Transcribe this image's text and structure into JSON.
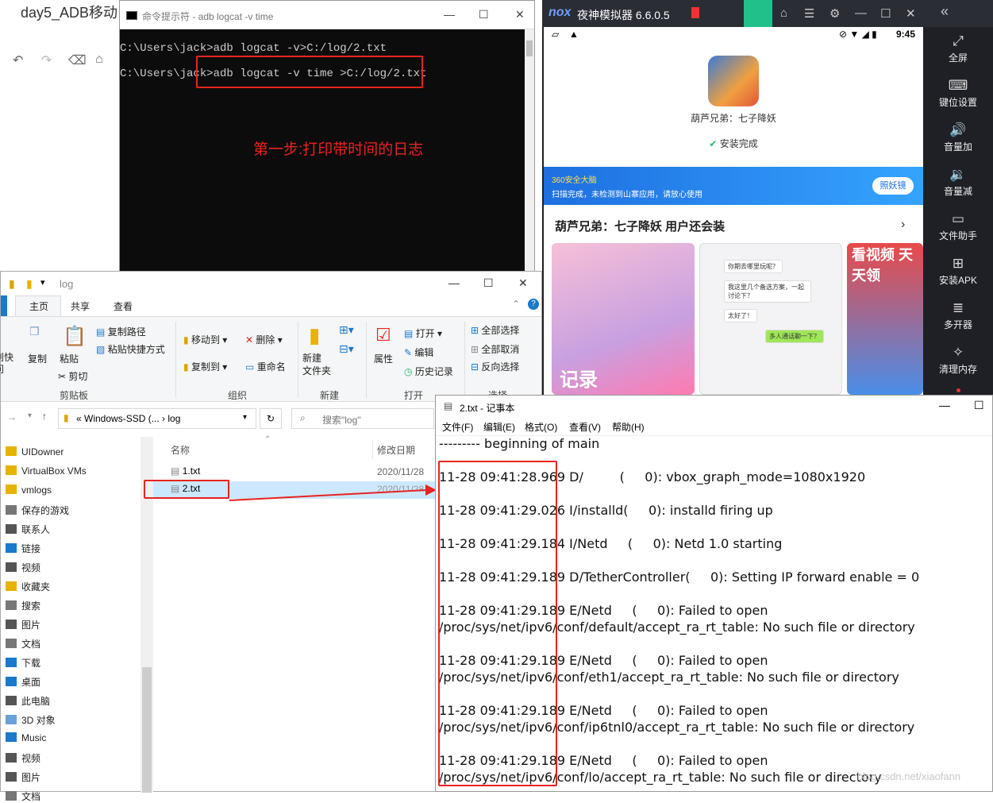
{
  "bgdoc": {
    "title": "day5_ADB移动"
  },
  "cmd": {
    "title": "命令提示符 - adb  logcat -v time",
    "line1": "C:\\Users\\jack>adb logcat -v>C:/log/2.txt",
    "line2": "C:\\Users\\jack>adb logcat -v time >C:/log/2.txt",
    "annotation": "第一步:打印带时间的日志"
  },
  "nox": {
    "brand": "nox",
    "title": "夜神模拟器 6.6.0.5",
    "time": "9:45",
    "app_name": "葫芦兄弟：七子降妖",
    "install_status": "安装完成",
    "banner_line1": "360安全大脑",
    "banner_line2": "扫描完成，未检测到山寨应用，请放心使用",
    "banner_button": "照妖镜",
    "section_title": "葫芦兄弟：七子降妖 用户还会装",
    "shot1_text": "记录",
    "shot3_text": "看视频 天天领",
    "chat": [
      "你期去哪里玩呢？",
      "我这里几个备选方案，一起讨论下？",
      "太好了！",
      "多人通话聊一下？"
    ],
    "sidebar": [
      "全屏",
      "键位设置",
      "音量加",
      "音量减",
      "文件助手",
      "安装APK",
      "多开器",
      "清理内存"
    ]
  },
  "explorer": {
    "title": "log",
    "tabs": [
      "文件",
      "主页",
      "共享",
      "查看"
    ],
    "ribbon": {
      "pin": "固定到快\n速访问",
      "copy": "复制",
      "paste": "粘贴",
      "copy_path": "复制路径",
      "paste_shortcut": "粘贴快捷方式",
      "cut": "剪切",
      "move_to": "移动到",
      "copy_to": "复制到",
      "delete": "删除",
      "rename": "重命名",
      "new_folder": "新建\n文件夹",
      "properties": "属性",
      "open": "打开",
      "edit": "编辑",
      "history": "历史记录",
      "select_all": "全部选择",
      "select_none": "全部取消",
      "invert": "反向选择",
      "groups": {
        "clipboard": "剪贴板",
        "organize": "组织",
        "new": "新建",
        "open": "打开",
        "select": "选择"
      }
    },
    "address": {
      "path1": "Windows-SSD (...",
      "path2": "log",
      "search_placeholder": "搜索\"log\""
    },
    "nav": [
      "UIDowner",
      "VirtualBox VMs",
      "vmlogs",
      "保存的游戏",
      "联系人",
      "链接",
      "视频",
      "收藏夹",
      "搜索",
      "图片",
      "文档",
      "下载",
      "桌面",
      "此电脑",
      "3D 对象",
      "Music",
      "视频",
      "图片",
      "文档"
    ],
    "columns": {
      "name": "名称",
      "date": "修改日期"
    },
    "files": [
      {
        "name": "1.txt",
        "date": "2020/11/28"
      },
      {
        "name": "2.txt",
        "date": "2020/11/28"
      }
    ]
  },
  "notepad": {
    "title": "2.txt - 记事本",
    "menu": [
      "文件(F)",
      "编辑(E)",
      "格式(O)",
      "查看(V)",
      "帮助(H)"
    ],
    "lines": [
      "--------- beginning of main",
      "11-28 09:41:28.969 D/         (     0): vbox_graph_mode=1080x1920",
      "11-28 09:41:29.026 I/installd(     0): installd firing up",
      "11-28 09:41:29.184 I/Netd     (     0): Netd 1.0 starting",
      "11-28 09:41:29.189 D/TetherController(     0): Setting IP forward enable = 0",
      "11-28 09:41:29.189 E/Netd     (     0): Failed to open",
      "/proc/sys/net/ipv6/conf/default/accept_ra_rt_table: No such file or directory",
      "11-28 09:41:29.189 E/Netd     (     0): Failed to open",
      "/proc/sys/net/ipv6/conf/eth1/accept_ra_rt_table: No such file or directory",
      "11-28 09:41:29.189 E/Netd     (     0): Failed to open",
      "/proc/sys/net/ipv6/conf/ip6tnl0/accept_ra_rt_table: No such file or directory",
      "11-28 09:41:29.189 E/Netd     (     0): Failed to open",
      "/proc/sys/net/ipv6/conf/lo/accept_ra_rt_table: No such file or directory"
    ]
  },
  "watermark": "blog.csdn.net/xiaofann"
}
